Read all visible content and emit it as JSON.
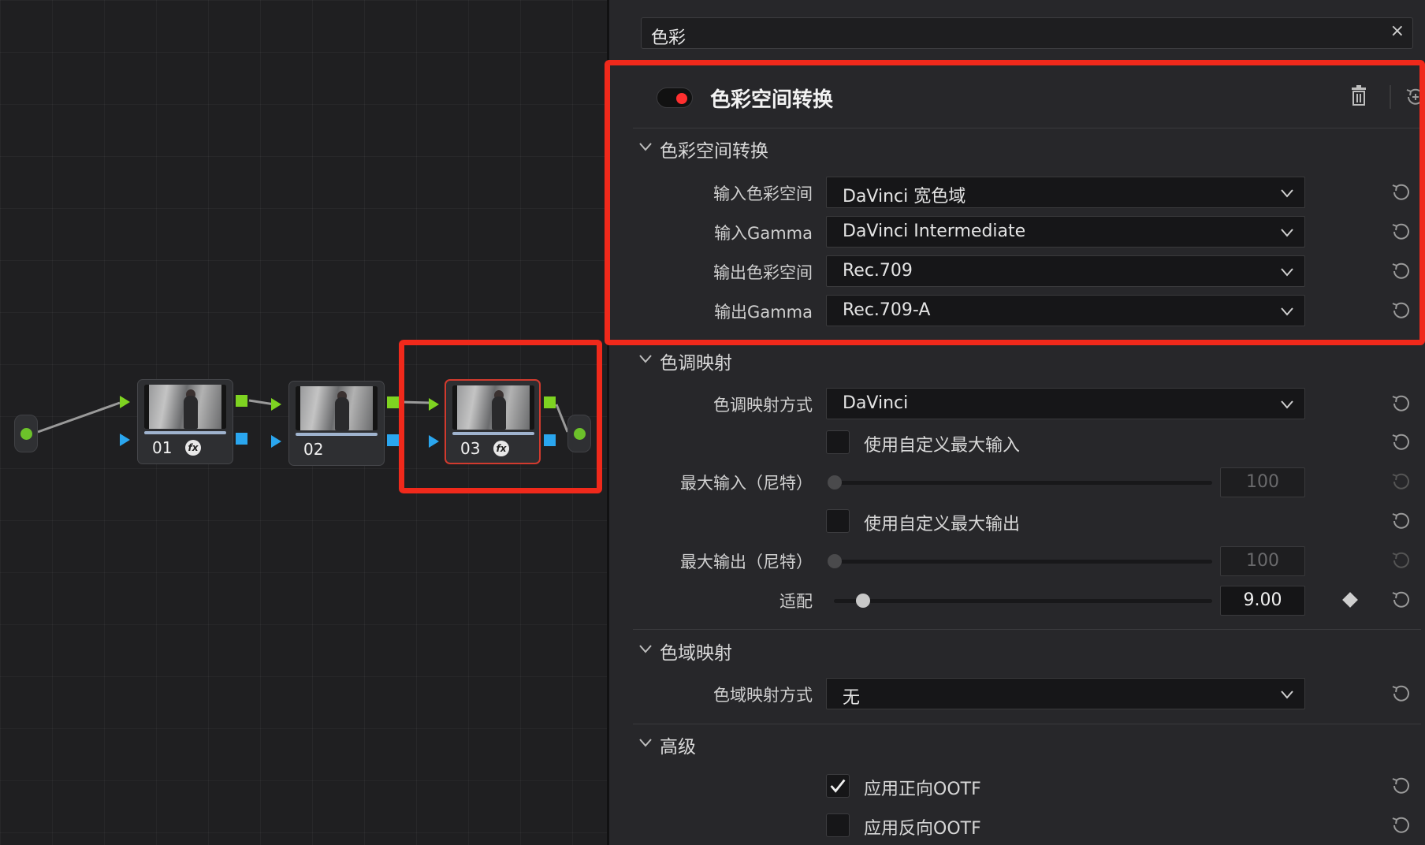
{
  "node_editor": {
    "nodes": [
      {
        "label": "01",
        "has_fx": true,
        "selected": false
      },
      {
        "label": "02",
        "has_fx": false,
        "selected": false
      },
      {
        "label": "03",
        "has_fx": true,
        "selected": true
      }
    ],
    "fx_symbol": "fx"
  },
  "inspector": {
    "search": {
      "value": "色彩",
      "clear_icon": "×"
    },
    "effect": {
      "title": "色彩空间转换",
      "enabled": true
    },
    "sections": {
      "csc": {
        "title": "色彩空间转换",
        "rows": [
          {
            "label": "输入色彩空间",
            "value": "DaVinci 宽色域"
          },
          {
            "label": "输入Gamma",
            "value": "DaVinci Intermediate"
          },
          {
            "label": "输出色彩空间",
            "value": "Rec.709"
          },
          {
            "label": "输出Gamma",
            "value": "Rec.709-A"
          }
        ]
      },
      "tone": {
        "title": "色调映射",
        "method_label": "色调映射方式",
        "method_value": "DaVinci",
        "custom_max_input_label": "使用自定义最大输入",
        "custom_max_input_checked": false,
        "max_input_label": "最大输入（尼特）",
        "max_input_value": "100",
        "custom_max_output_label": "使用自定义最大输出",
        "custom_max_output_checked": false,
        "max_output_label": "最大输出（尼特）",
        "max_output_value": "100",
        "adapt_label": "适配",
        "adapt_value": "9.00"
      },
      "gamut": {
        "title": "色域映射",
        "method_label": "色域映射方式",
        "method_value": "无"
      },
      "advanced": {
        "title": "高级",
        "apply_forward_ootf_label": "应用正向OOTF",
        "apply_forward_ootf_checked": true,
        "apply_inverse_ootf_label": "应用反向OOTF",
        "apply_inverse_ootf_checked": false
      }
    }
  },
  "colors": {
    "accent_red": "#f0291b",
    "port_green": "#7ed321",
    "port_blue": "#2aa6ef",
    "toggle_on": "#ff2f2f"
  }
}
